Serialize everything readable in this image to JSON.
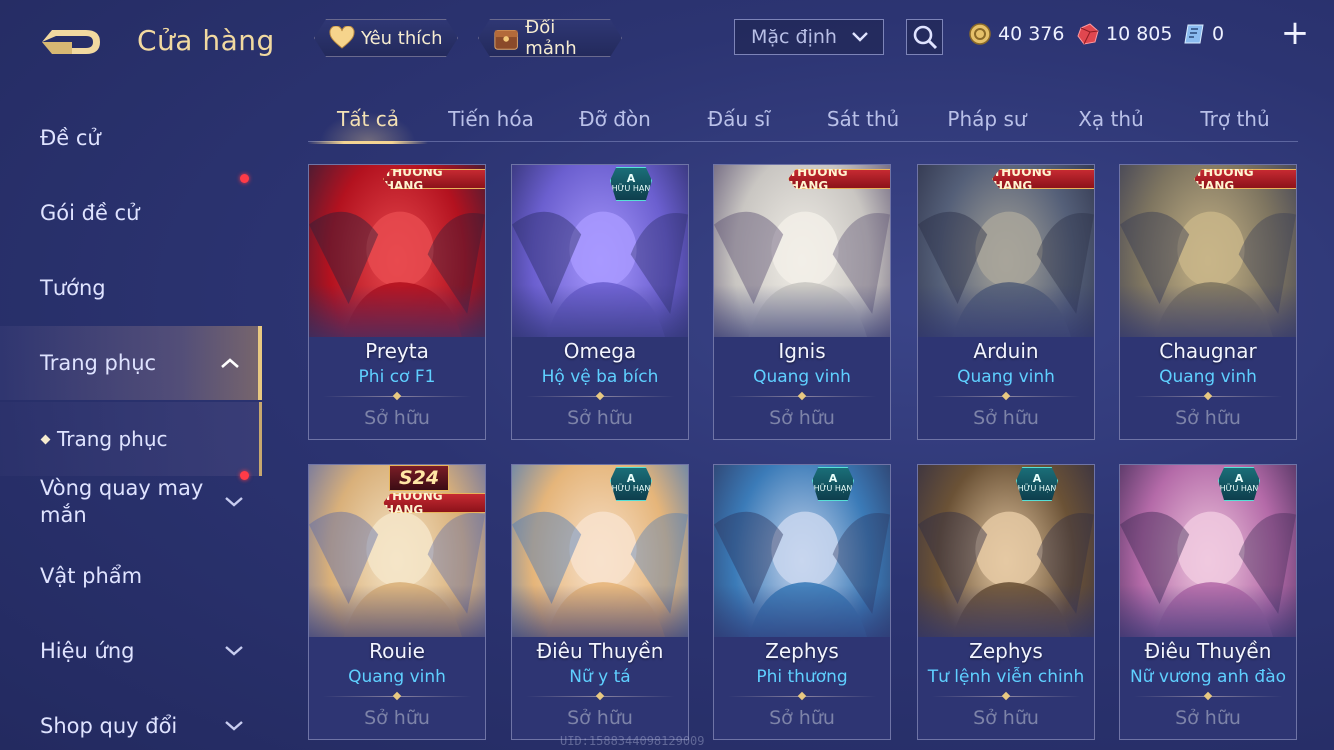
{
  "header": {
    "title": "Cửa hàng",
    "favorite_label": "Yêu thích",
    "shard_label": "Đổi mảnh",
    "sort_value": "Mặc định",
    "gold": "40 376",
    "gems": "10 805",
    "vouchers": "0"
  },
  "sidebar": {
    "items": [
      {
        "label": "Đề cử"
      },
      {
        "label": "Gói đề cử"
      },
      {
        "label": "Tướng"
      },
      {
        "label": "Trang phục"
      },
      {
        "label": "Trang phục"
      },
      {
        "label": "Vòng quay may mắn"
      },
      {
        "label": "Vật phẩm"
      },
      {
        "label": "Hiệu ứng"
      },
      {
        "label": "Shop quy đổi"
      }
    ]
  },
  "tabs": [
    "Tất cả",
    "Tiến hóa",
    "Đỡ đòn",
    "Đấu sĩ",
    "Sát thủ",
    "Pháp sư",
    "Xạ thủ",
    "Trợ thủ"
  ],
  "badges": {
    "rank": "THƯỞNG HẠNG",
    "limited_grade": "A",
    "limited": "HỮU HẠN",
    "season": "S24"
  },
  "owned_label": "Sở hữu",
  "cards": [
    {
      "name": "Preyta",
      "skin": "Phi cơ F1",
      "badge": "rank",
      "palette": [
        "#b3121f",
        "#e84a4f",
        "#2a1f3a"
      ]
    },
    {
      "name": "Omega",
      "skin": "Hộ vệ ba bích",
      "badge": "limited",
      "palette": [
        "#6b5fcf",
        "#a899ff",
        "#2a2c66"
      ]
    },
    {
      "name": "Ignis",
      "skin": "Quang vinh",
      "badge": "rank",
      "palette": [
        "#c9c6c2",
        "#f2efe8",
        "#5a5070"
      ]
    },
    {
      "name": "Arduin",
      "skin": "Quang vinh",
      "badge": "rank",
      "palette": [
        "#545f78",
        "#a8a59a",
        "#2b2f47"
      ]
    },
    {
      "name": "Chaugnar",
      "skin": "Quang vinh",
      "badge": "rank",
      "palette": [
        "#7e7560",
        "#c8b588",
        "#383b55"
      ]
    },
    {
      "name": "Rouie",
      "skin": "Quang vinh",
      "badge": "season",
      "palette": [
        "#d9b07a",
        "#f5e5c8",
        "#5b6aa8"
      ]
    },
    {
      "name": "Điêu Thuyền",
      "skin": "Nữ y tá",
      "badge": "limited",
      "palette": [
        "#e5b57a",
        "#f8e2cc",
        "#4a7ab7"
      ]
    },
    {
      "name": "Zephys",
      "skin": "Phi thương",
      "badge": "limited",
      "palette": [
        "#3b7bb8",
        "#c8d6ee",
        "#2c3660"
      ]
    },
    {
      "name": "Zephys",
      "skin": "Tư lệnh viễn chinh",
      "badge": "limited",
      "palette": [
        "#6b5236",
        "#e5c9a3",
        "#2f2c44"
      ]
    },
    {
      "name": "Điêu Thuyền",
      "skin": "Nữ vương anh đào",
      "badge": "limited",
      "palette": [
        "#b46aa8",
        "#f0c9df",
        "#3f2a55"
      ]
    }
  ],
  "watermark": "UID:1588344098129009",
  "colors": {
    "accent_gold": "#f1d9a0",
    "skin_blue": "#5fd0ff",
    "notify_red": "#ff3b47"
  }
}
